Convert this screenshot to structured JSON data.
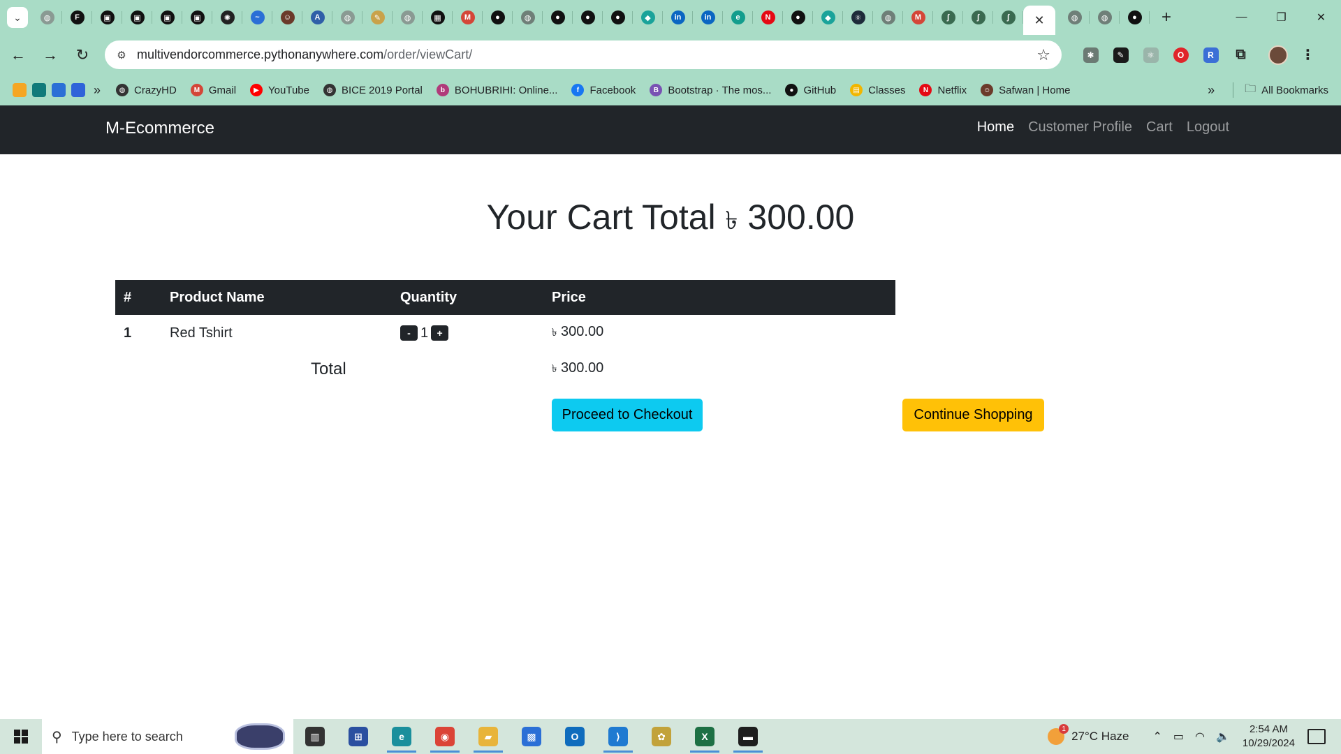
{
  "browser": {
    "tabs": [
      {
        "icon": "globe-icon",
        "color": "#8a9a93"
      },
      {
        "icon": "framer-icon",
        "color": "#111111"
      },
      {
        "icon": "square-app-icon",
        "color": "#111111"
      },
      {
        "icon": "square-app-icon",
        "color": "#111111"
      },
      {
        "icon": "square-app-icon",
        "color": "#111111"
      },
      {
        "icon": "square-app-icon",
        "color": "#111111"
      },
      {
        "icon": "openai-icon",
        "color": "#222222"
      },
      {
        "icon": "flow-icon",
        "color": "#2b6fd6"
      },
      {
        "icon": "person-icon",
        "color": "#6b3a2a"
      },
      {
        "icon": "sketch-icon",
        "color": "#2f5fa8"
      },
      {
        "icon": "globe-icon",
        "color": "#8a9a93"
      },
      {
        "icon": "pen-icon",
        "color": "#c9a24a"
      },
      {
        "icon": "globe-icon",
        "color": "#8a9a93"
      },
      {
        "icon": "calendar-icon",
        "color": "#111111"
      },
      {
        "icon": "gmail-icon",
        "color": "#d44638"
      },
      {
        "icon": "github-icon",
        "color": "#111111"
      },
      {
        "icon": "globe-icon",
        "color": "#6f7f78"
      },
      {
        "icon": "github-icon",
        "color": "#111111"
      },
      {
        "icon": "github-icon",
        "color": "#111111"
      },
      {
        "icon": "github-icon",
        "color": "#111111"
      },
      {
        "icon": "diamond-icon",
        "color": "#1aa39a"
      },
      {
        "icon": "linkedin-icon",
        "color": "#0a66c2"
      },
      {
        "icon": "linkedin-icon",
        "color": "#0a66c2"
      },
      {
        "icon": "edge-icon",
        "color": "#139d8d"
      },
      {
        "icon": "netflix-icon",
        "color": "#e50914"
      },
      {
        "icon": "github-icon",
        "color": "#111111"
      },
      {
        "icon": "diamond-icon",
        "color": "#1aa39a"
      },
      {
        "icon": "react-icon",
        "color": "#1e2b3a"
      },
      {
        "icon": "globe-icon",
        "color": "#6f7f78"
      },
      {
        "icon": "gmail-icon",
        "color": "#d44638"
      },
      {
        "icon": "python-icon",
        "color": "#3a6a50"
      },
      {
        "icon": "python-icon",
        "color": "#3a6a50"
      },
      {
        "icon": "python-icon",
        "color": "#3a6a50"
      }
    ],
    "tabs_after": [
      {
        "icon": "globe-icon",
        "color": "#6f7f78"
      },
      {
        "icon": "globe-icon",
        "color": "#6f7f78"
      },
      {
        "icon": "github-icon",
        "color": "#111111"
      }
    ],
    "new_tab": "+",
    "url_host": "multivendorcommerce.pythonanywhere.com",
    "url_path": "/order/viewCart/",
    "bookmarks": [
      {
        "label": "CrazyHD",
        "icon": "globe-icon",
        "color": "#333333"
      },
      {
        "label": "Gmail",
        "icon": "gmail-icon",
        "color": "#d44638"
      },
      {
        "label": "YouTube",
        "icon": "youtube-icon",
        "color": "#ff0000"
      },
      {
        "label": "BICE 2019 Portal",
        "icon": "globe-icon",
        "color": "#333333"
      },
      {
        "label": "BOHUBRIHI: Online...",
        "icon": "bohubrihi-icon",
        "color": "#b03a7a"
      },
      {
        "label": "Facebook",
        "icon": "facebook-icon",
        "color": "#1877f2"
      },
      {
        "label": "Bootstrap · The mos...",
        "icon": "bootstrap-icon",
        "color": "#7952b3"
      },
      {
        "label": "GitHub",
        "icon": "github-icon",
        "color": "#111111"
      },
      {
        "label": "Classes",
        "icon": "classroom-icon",
        "color": "#f1b600"
      },
      {
        "label": "Netflix",
        "icon": "netflix-icon",
        "color": "#e50914"
      },
      {
        "label": "Safwan | Home",
        "icon": "person-icon",
        "color": "#6b3a2a"
      }
    ],
    "all_bookmarks": "All Bookmarks"
  },
  "site": {
    "brand": "M-Ecommerce",
    "nav": {
      "home": "Home",
      "profile": "Customer Profile",
      "cart": "Cart",
      "logout": "Logout"
    },
    "title_prefix": "Your Cart Total",
    "currency": "৳",
    "title_amount": "300.00",
    "table": {
      "headers": [
        "#",
        "Product Name",
        "Quantity",
        "Price"
      ],
      "rows": [
        {
          "num": "1",
          "name": "Red Tshirt",
          "minus": "-",
          "qty": "1",
          "plus": "+",
          "currency": "৳",
          "price": "300.00"
        }
      ],
      "total_label": "Total",
      "total_currency": "৳",
      "total_value": "300.00"
    },
    "checkout_label": "Proceed to Checkout",
    "continue_label": "Continue Shopping"
  },
  "taskbar": {
    "search_placeholder": "Type here to search",
    "apps": [
      {
        "icon": "task-view-icon",
        "color": "#333333",
        "running": false
      },
      {
        "icon": "network-app-icon",
        "color": "#2a4fa0",
        "running": false
      },
      {
        "icon": "edge-icon",
        "color": "#1a8f9c",
        "running": true
      },
      {
        "icon": "chrome-icon",
        "color": "#db4437",
        "running": true
      },
      {
        "icon": "file-explorer-icon",
        "color": "#e8b43a",
        "running": true
      },
      {
        "icon": "store-icon",
        "color": "#2b6fd6",
        "running": false
      },
      {
        "icon": "outlook-icon",
        "color": "#0f6cbd",
        "running": false
      },
      {
        "icon": "vscode-icon",
        "color": "#1f7ad1",
        "running": true
      },
      {
        "icon": "paint-icon",
        "color": "#c2a23a",
        "running": false
      },
      {
        "icon": "excel-icon",
        "color": "#1d7044",
        "running": true
      },
      {
        "icon": "terminal-icon",
        "color": "#1e1e1e",
        "running": true
      }
    ],
    "weather": "27°C  Haze",
    "time": "2:54 AM",
    "date": "10/29/2024"
  }
}
